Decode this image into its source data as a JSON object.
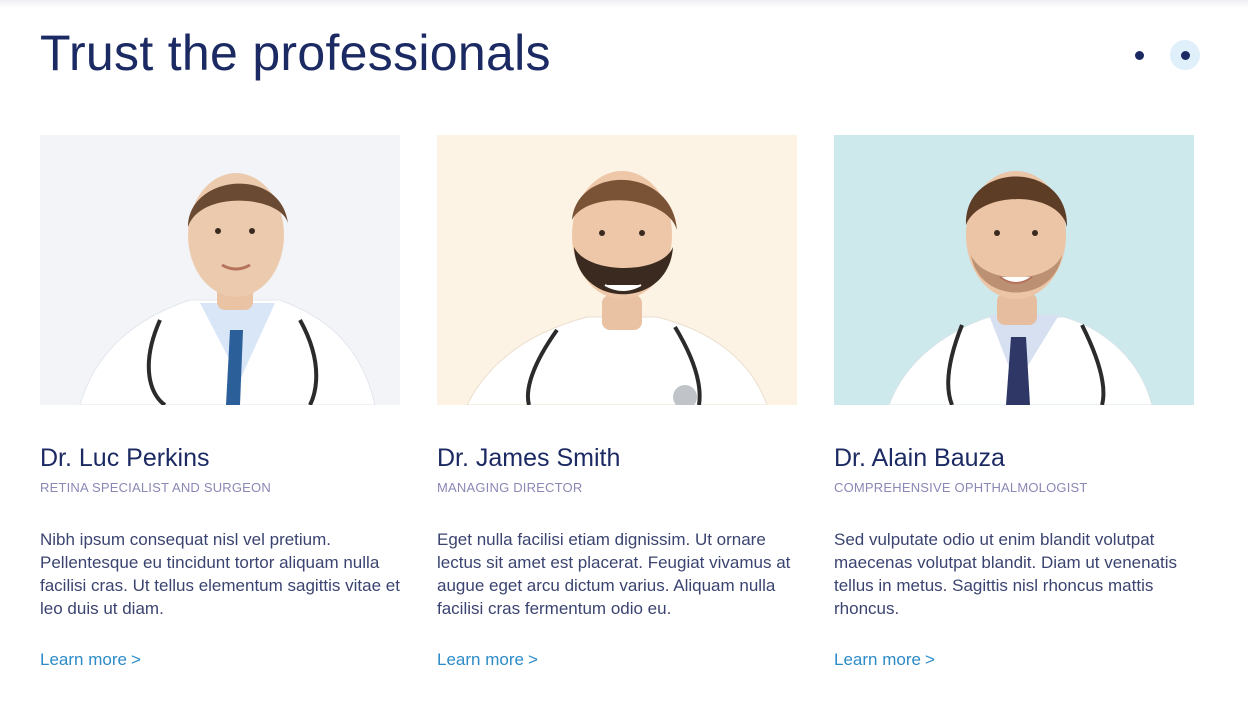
{
  "section": {
    "title": "Trust the professionals"
  },
  "pager": {
    "pages": 2,
    "active_index": 1
  },
  "colors": {
    "heading": "#1c2a63",
    "role": "#8a88b5",
    "link": "#2d8bc8",
    "pager_active_bg": "#dff0fb"
  },
  "doctors": [
    {
      "name": "Dr. Luc Perkins",
      "role": "RETINA SPECIALIST AND SURGEON",
      "bio": "Nibh ipsum consequat nisl vel pretium. Pellentesque eu tincidunt tortor aliquam nulla facilisi cras. Ut tellus elementum sagittis vitae et leo duis ut diam.",
      "link": "Learn more",
      "photo_bg": "#f3f4f7"
    },
    {
      "name": "Dr. James Smith",
      "role": "MANAGING DIRECTOR",
      "bio": "Eget nulla facilisi etiam dignissim. Ut ornare lectus sit amet est placerat. Feugiat vivamus at augue eget arcu dictum varius. Aliquam nulla facilisi cras fermentum odio eu.",
      "link": "Learn more",
      "photo_bg": "#fdf3e4"
    },
    {
      "name": "Dr. Alain Bauza",
      "role": "COMPREHENSIVE OPHTHALMOLOGIST",
      "bio": "Sed vulputate odio ut enim blandit volutpat maecenas volutpat blandit. Diam ut venenatis tellus in metus. Sagittis nisl rhoncus mattis rhoncus.",
      "link": "Learn more",
      "photo_bg": "#cde9ec"
    }
  ]
}
